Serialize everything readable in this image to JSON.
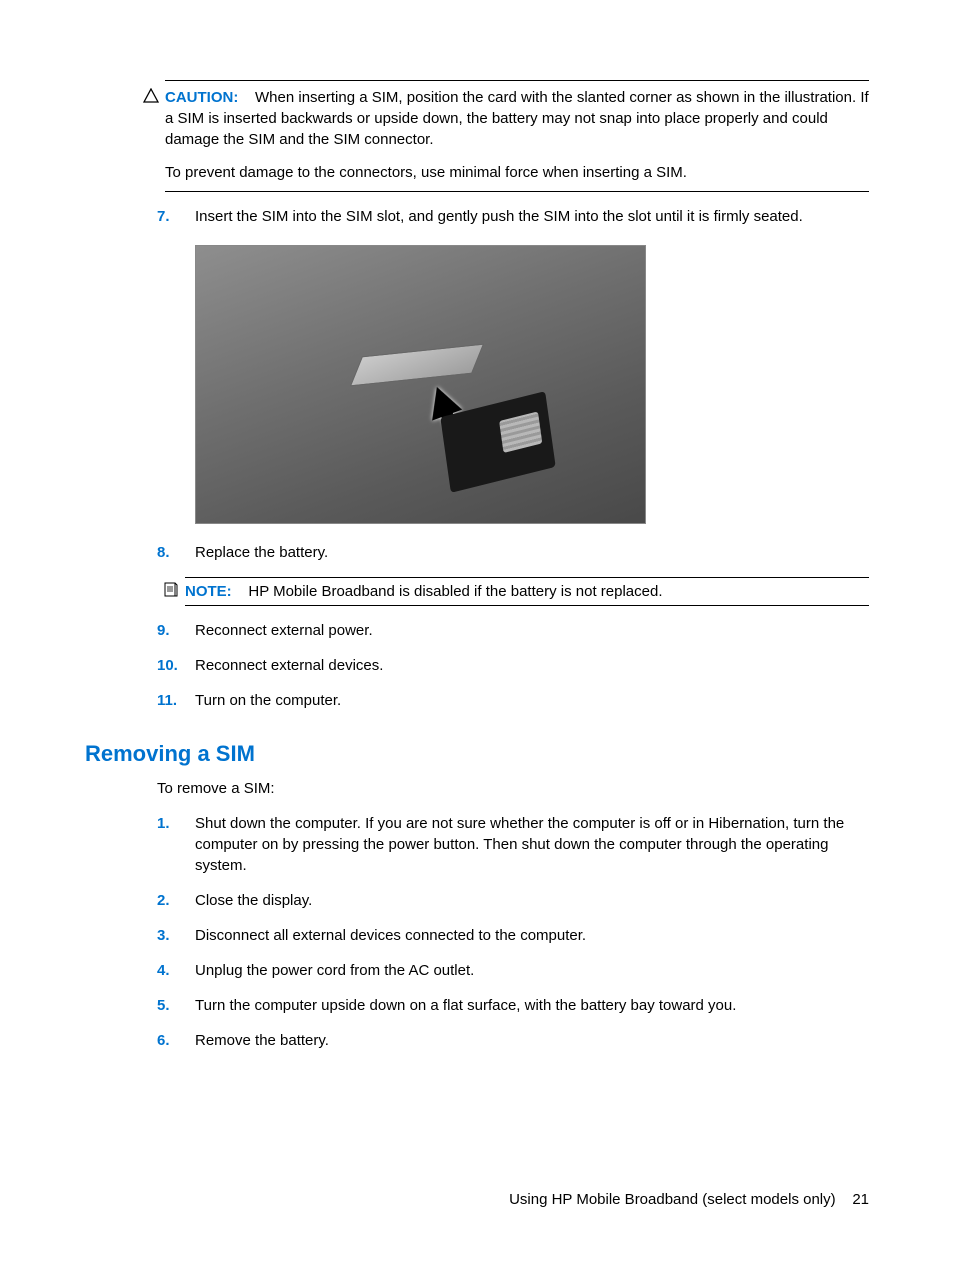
{
  "caution": {
    "label": "CAUTION:",
    "para1": "When inserting a SIM, position the card with the slanted corner as shown in the illustration. If a SIM is inserted backwards or upside down, the battery may not snap into place properly and could damage the SIM and the SIM connector.",
    "para2": "To prevent damage to the connectors, use minimal force when inserting a SIM."
  },
  "steps_top": [
    {
      "num": "7.",
      "text": "Insert the SIM into the SIM slot, and gently push the SIM into the slot until it is firmly seated."
    }
  ],
  "steps_after_fig": [
    {
      "num": "8.",
      "text": "Replace the battery."
    }
  ],
  "note": {
    "label": "NOTE:",
    "text": "HP Mobile Broadband is disabled if the battery is not replaced."
  },
  "steps_after_note": [
    {
      "num": "9.",
      "text": "Reconnect external power."
    },
    {
      "num": "10.",
      "text": "Reconnect external devices."
    },
    {
      "num": "11.",
      "text": "Turn on the computer."
    }
  ],
  "section": {
    "heading": "Removing a SIM",
    "intro": "To remove a SIM:",
    "steps": [
      {
        "num": "1.",
        "text": "Shut down the computer. If you are not sure whether the computer is off or in Hibernation, turn the computer on by pressing the power button. Then shut down the computer through the operating system."
      },
      {
        "num": "2.",
        "text": "Close the display."
      },
      {
        "num": "3.",
        "text": "Disconnect all external devices connected to the computer."
      },
      {
        "num": "4.",
        "text": "Unplug the power cord from the AC outlet."
      },
      {
        "num": "5.",
        "text": "Turn the computer upside down on a flat surface, with the battery bay toward you."
      },
      {
        "num": "6.",
        "text": "Remove the battery."
      }
    ]
  },
  "footer": {
    "text": "Using HP Mobile Broadband (select models only)",
    "page": "21"
  }
}
